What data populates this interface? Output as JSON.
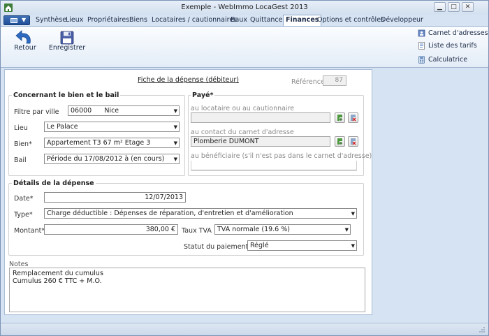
{
  "window": {
    "title": "Exemple - WebImmo LocaGest 2013"
  },
  "tabs": [
    "Synthèse",
    "Lieux",
    "Propriétaires",
    "Biens",
    "Locataires / cautionnaires",
    "Baux",
    "Quittances",
    "Finances",
    "Options et contrôles",
    "Développeur"
  ],
  "active_tab": "Finances",
  "ribbon": {
    "retour": "Retour",
    "enregistrer": "Enregistrer",
    "carnet": "Carnet d'adresses",
    "tarifs": "Liste des tarifs",
    "calculatrice": "Calculatrice"
  },
  "form": {
    "title": "Fiche de la dépense (débiteur)",
    "reference_label": "Référence",
    "reference_value": "87",
    "bien_group": {
      "title": "Concernant le bien et le bail",
      "filtre_label": "Filtre par ville",
      "filtre_value": "06000      Nice",
      "lieu_label": "Lieu",
      "lieu_value": "Le Palace",
      "bien_label": "Bien*",
      "bien_value": "Appartement T3 67 m² Etage 3",
      "bail_label": "Bail",
      "bail_value": "Période du 17/08/2012 à (en cours)"
    },
    "paye_group": {
      "title": "Payé*",
      "locataire_label": "au locataire ou au cautionnaire",
      "locataire_value": "",
      "contact_label": "au contact du carnet d'adresse",
      "contact_value": "Plomberie DUMONT",
      "beneficiaire_label": "au bénéficiaire (s'il n'est pas dans le carnet d'adresse)",
      "beneficiaire_value": ""
    },
    "details_group": {
      "title": "Détails de la dépense",
      "date_label": "Date*",
      "date_value": "12/07/2013",
      "type_label": "Type*",
      "type_value": "Charge déductible : Dépenses de réparation, d'entretien et d'amélioration",
      "montant_label": "Montant*",
      "montant_value": "380,00 €",
      "tva_label": "Taux TVA",
      "tva_value": "TVA normale (19.6 %)",
      "statut_label": "Statut du paiement*",
      "statut_value": "Réglé"
    },
    "notes_label": "Notes",
    "notes_lines": [
      "Remplacement du cumulus",
      "Cumulus 260 € TTC + M.O."
    ]
  },
  "colors": {
    "accent": "#1f4f98",
    "workspace": "#d6e3f2",
    "ribbon": "#e3ecf7"
  },
  "icons": [
    "app-icon",
    "menu-icon",
    "back-arrow-icon",
    "save-icon",
    "address-book-icon",
    "price-list-icon",
    "calculator-icon",
    "add-contact-icon",
    "remove-contact-icon",
    "resize-grip-icon"
  ]
}
